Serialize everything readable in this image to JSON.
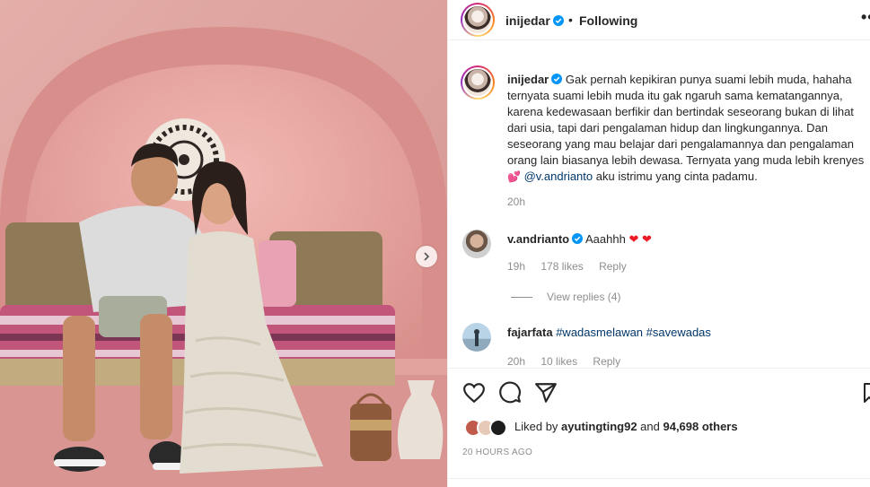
{
  "photo": {
    "alt_icon": "carousel-next-icon"
  },
  "header": {
    "username": "inijedar",
    "separator": "•",
    "follow_status": "Following",
    "more": "•••"
  },
  "caption": {
    "username": "inijedar",
    "lines": [
      "Gak pernah kepikiran punya suami lebih muda, hahaha",
      "ternyata suami lebih muda itu gak ngaruh sama kematangannya,",
      "karena kedewasaan berfikir dan bertindak seseorang bukan di lihat",
      "dari usia, tapi dari pengalaman hidup dan lingkungannya. Dan",
      "seseorang yang mau belajar dari pengalamannya dan pengalaman",
      "orang lain biasanya lebih dewasa. Ternyata yang muda lebih krenyes"
    ],
    "emoji": "💕",
    "mention": "@v.andrianto",
    "last_text": " aku istrimu yang cinta padamu.",
    "time": "20h"
  },
  "comments": [
    {
      "username": "v.andrianto",
      "text": "Aaahhh",
      "hearts": "❤ ❤",
      "time": "19h",
      "likes": "178 likes",
      "reply": "Reply",
      "view_replies": "View replies (4)"
    },
    {
      "username": "fajarfata",
      "hashtags": "#wadasmelawan #savewadas",
      "time": "20h",
      "likes": "10 likes",
      "reply": "Reply"
    }
  ],
  "actions": {
    "liked_by_prefix": "Liked by ",
    "liked_by_user": "ayutingting92",
    "liked_by_and": " and ",
    "liked_by_count": "94,698 others",
    "post_time": "20 HOURS AGO"
  },
  "colors": {
    "text_primary": "#262626",
    "text_secondary": "#8e8e8e",
    "link": "#00376b",
    "verified": "#0095f6",
    "photo_wall": "#dfa29f"
  }
}
